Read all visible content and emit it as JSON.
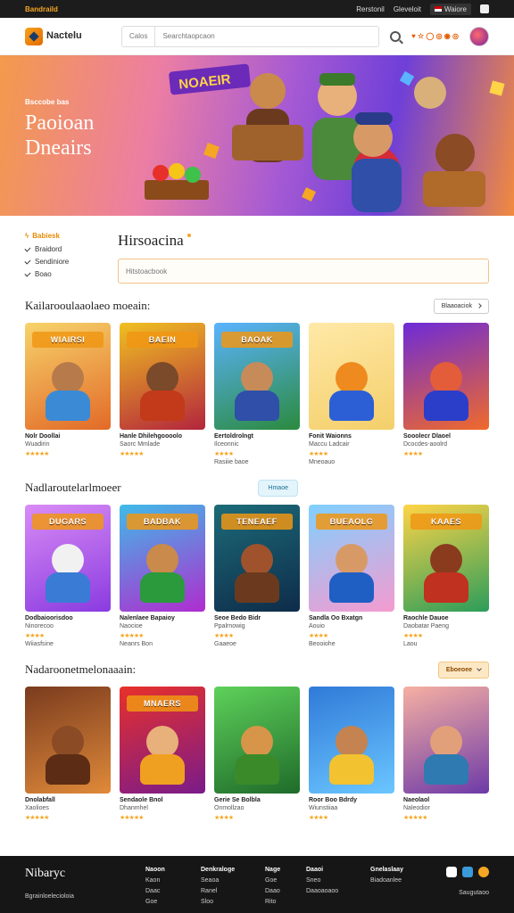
{
  "topbar": {
    "brand": "Bandraild",
    "link1": "Rerstonil",
    "link2": "Gleveloit",
    "lang": "Waiore"
  },
  "header": {
    "logo_text": "Nactelu",
    "search_category": "Calos",
    "search_placeholder": "Searchtaopcaon",
    "nav_links": "♥ ☆ ◯ ◎ ◉ ◎"
  },
  "hero": {
    "kicker": "Bsccobe bas",
    "title_line1": "Paoioan",
    "title_line2": "Dneairs",
    "art_sign": "NOAEIR"
  },
  "filters": {
    "heading": "Babiesk",
    "items": [
      "Braidord",
      "Sendiniore",
      "Boao"
    ],
    "title": "Hirsoacina",
    "input_placeholder": "Hitstoacbook"
  },
  "sections": [
    {
      "title": "Kailarooulaaolaeo moeain:",
      "control": "Blaaoaciok",
      "cards": [
        {
          "title": "Nolr Doollai",
          "sub": "Wuadirin",
          "extra": "",
          "stars": "★★★★★",
          "banner": "WIAIRSI",
          "c1": "#f7d36b",
          "c2": "#e26a27",
          "skin": "#b77a4a",
          "shirt": "#3b8ad6"
        },
        {
          "title": "Hanle Dhilehgoooolo",
          "sub": "Saorc Mmlade",
          "extra": "",
          "stars": "★★★★★",
          "banner": "BAEIN",
          "c1": "#f0c021",
          "c2": "#b3253d",
          "skin": "#7a4a2a",
          "shirt": "#c23a1a"
        },
        {
          "title": "Eertoldrolngt",
          "sub": "Ilceonnic",
          "extra": "Rasiiie baoe",
          "stars": "★★★★",
          "banner": "BAOAK",
          "c1": "#5ab3ff",
          "c2": "#2b8a3e",
          "skin": "#c78b5a",
          "shirt": "#2f4fa8"
        },
        {
          "title": "Fonit Waionns",
          "sub": "Maccu Ladcair",
          "extra": "Mneoauo",
          "stars": "★★★★",
          "banner": "",
          "c1": "#ffe9a8",
          "c2": "#f4cf6a",
          "skin": "#ef8a1f",
          "shirt": "#2c5fd6"
        },
        {
          "title": "Sooolecr Dlaoel",
          "sub": "Dcocdes-aoolrd",
          "extra": "",
          "stars": "★★★★",
          "banner": "",
          "c1": "#6d2bd8",
          "c2": "#f06a2a",
          "skin": "#e35d3a",
          "shirt": "#2b3ec9"
        }
      ]
    },
    {
      "title": "Nadlaroutelarlmoeer",
      "control": "Hmaoe",
      "cards": [
        {
          "title": "Dodbaioorisdoo",
          "sub": "Ninorecoo",
          "extra": "Wiiasfsine",
          "stars": "★★★★",
          "banner": "DUGARS",
          "c1": "#d98cf5",
          "c2": "#8a3be0",
          "skin": "#f1f1f1",
          "shirt": "#3a7bd5"
        },
        {
          "title": "Nalenlaee Bapaioy",
          "sub": "Naocioe",
          "extra": "Neanrs Bon",
          "stars": "★★★★★",
          "banner": "BADBAK",
          "c1": "#3fbbe8",
          "c2": "#b02ccf",
          "skin": "#c98a4b",
          "shirt": "#2a9a3c"
        },
        {
          "title": "Seoe Bedo Bidr",
          "sub": "Ppalrnowig",
          "extra": "Gaaeoe",
          "stars": "★★★★",
          "banner": "TENEAEF",
          "c1": "#1c6b78",
          "c2": "#0e2c4a",
          "skin": "#a0522d",
          "shirt": "#6b3a1e"
        },
        {
          "title": "Sandla Oo Bxatgn",
          "sub": "Aouio",
          "extra": "Beooiohe",
          "stars": "★★★★",
          "banner": "BUEAOLG",
          "c1": "#7fd0ff",
          "c2": "#f59bd0",
          "skin": "#d79a67",
          "shirt": "#1f5fc4"
        },
        {
          "title": "Raochle Dauoe",
          "sub": "Daobatar Paeng",
          "extra": "Laou",
          "stars": "★★★★",
          "banner": "KAAES",
          "c1": "#ffd447",
          "c2": "#2b9d5a",
          "skin": "#8a3b1e",
          "shirt": "#c0311f"
        }
      ]
    },
    {
      "title": "Nadaroonetmelonaaain:",
      "control": "Eboeoee",
      "cards": [
        {
          "title": "Dnolabfall",
          "sub": "Xaolioes",
          "extra": "",
          "stars": "★★★★★",
          "banner": "",
          "c1": "#7a3b1e",
          "c2": "#e08a3a",
          "skin": "#8a4b25",
          "shirt": "#5c2d14"
        },
        {
          "title": "Sendaole Bnol",
          "sub": "Dhanmhel",
          "extra": "",
          "stars": "★★★★★",
          "banner": "MNAERS",
          "c1": "#e8302a",
          "c2": "#7a1b8a",
          "skin": "#e8b07a",
          "shirt": "#f0a020"
        },
        {
          "title": "Gerie Se Bolbla",
          "sub": "Onmollzao",
          "extra": "",
          "stars": "★★★★",
          "banner": "",
          "c1": "#5ed15a",
          "c2": "#1f6b2a",
          "skin": "#d69548",
          "shirt": "#3b8a2a"
        },
        {
          "title": "Roor Boo Bdrdy",
          "sub": "Wiunstiiaa",
          "extra": "",
          "stars": "★★★★",
          "banner": "",
          "c1": "#2f7ad8",
          "c2": "#6bc6ff",
          "skin": "#c48350",
          "shirt": "#f2c230"
        },
        {
          "title": "Naeolaol",
          "sub": "Naleodior",
          "extra": "",
          "stars": "★★★★★",
          "banner": "",
          "c1": "#f6b0a2",
          "c2": "#6d3aa8",
          "skin": "#e2a07a",
          "shirt": "#2f7ab0"
        }
      ]
    }
  ],
  "footer": {
    "brand": "Nibaryc",
    "brand_sub": "Bgrainloelecioloia",
    "columns": [
      {
        "head": "Naoon",
        "items": [
          "Kaon",
          "Daac",
          "Goe"
        ]
      },
      {
        "head": "Denkraloge",
        "items": [
          "Seaoa",
          "Ranel",
          "Sloo"
        ]
      },
      {
        "head": "Nage",
        "items": [
          "Goe",
          "Daao",
          "Rito"
        ]
      },
      {
        "head": "Daaoi",
        "items": [
          "Sneo",
          "Daaoaoaoo",
          ""
        ]
      },
      {
        "head": "Gnelaslaay",
        "items": [
          "Biadoanlee",
          ""
        ]
      }
    ],
    "social_caption": "Saugutaoo"
  }
}
